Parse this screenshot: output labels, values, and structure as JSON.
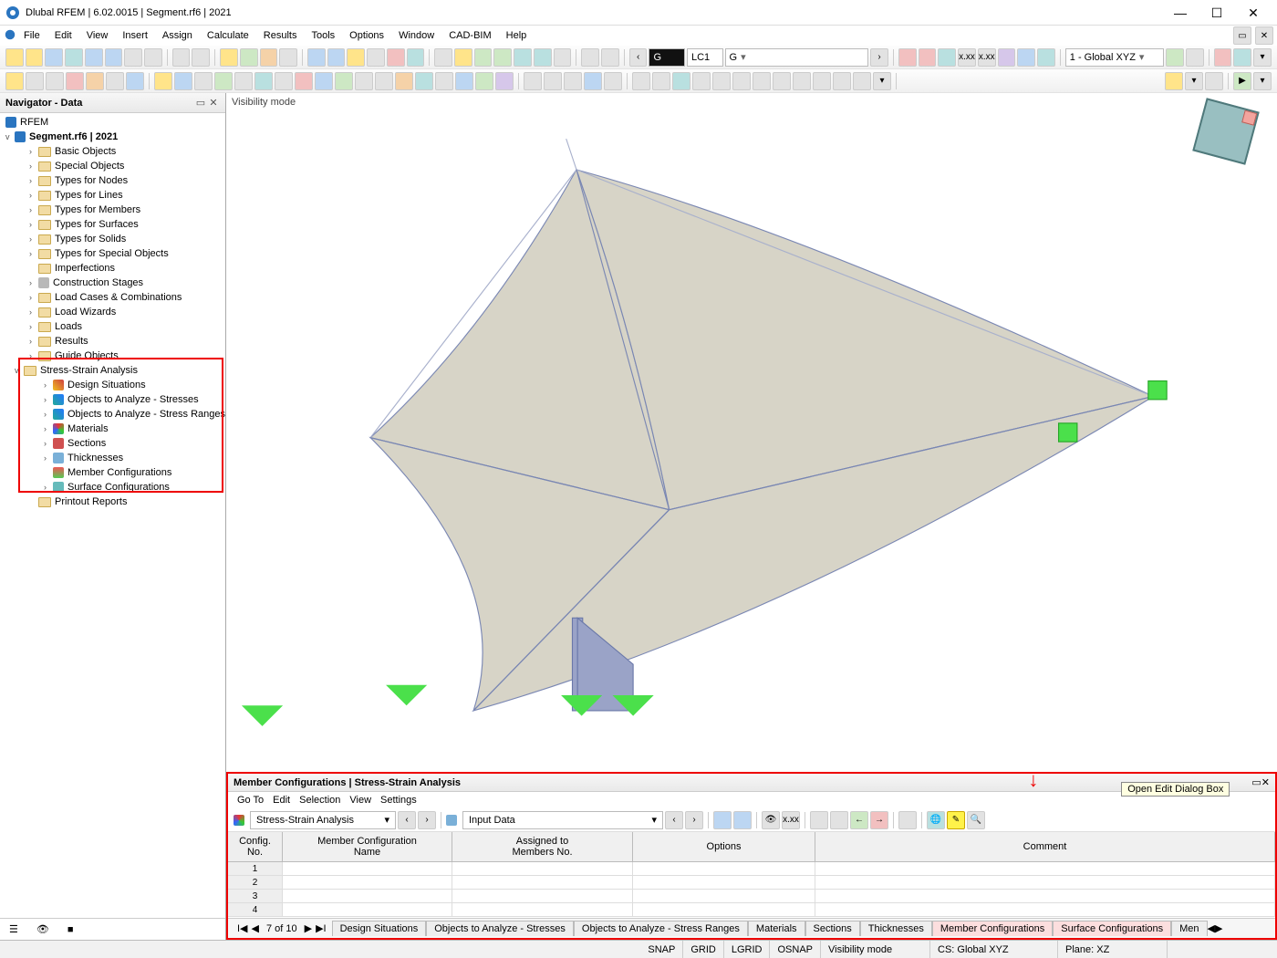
{
  "titlebar": {
    "text": "Dlubal RFEM | 6.02.0015 | Segment.rf6 | 2021"
  },
  "menubar": {
    "items": [
      "File",
      "Edit",
      "View",
      "Insert",
      "Assign",
      "Calculate",
      "Results",
      "Tools",
      "Options",
      "Window",
      "CAD-BIM",
      "Help"
    ]
  },
  "toolbar1": {
    "g_label": "G",
    "lc_code": "LC1",
    "lc_name": "G",
    "coord_sys": "1 - Global XYZ"
  },
  "navigator": {
    "title": "Navigator - Data",
    "root": "RFEM",
    "model": "Segment.rf6 | 2021",
    "basic": [
      "Basic Objects",
      "Special Objects",
      "Types for Nodes",
      "Types for Lines",
      "Types for Members",
      "Types for Surfaces",
      "Types for Solids",
      "Types for Special Objects",
      "Imperfections",
      "Construction Stages",
      "Load Cases & Combinations",
      "Load Wizards",
      "Loads",
      "Results",
      "Guide Objects"
    ],
    "ssa_label": "Stress-Strain Analysis",
    "ssa_children": [
      "Design Situations",
      "Objects to Analyze - Stresses",
      "Objects to Analyze - Stress Ranges",
      "Materials",
      "Sections",
      "Thicknesses",
      "Member Configurations",
      "Surface Configurations"
    ],
    "printout": "Printout Reports"
  },
  "viewport": {
    "mode_label": "Visibility mode"
  },
  "bottom_panel": {
    "title": "Member Configurations | Stress-Strain Analysis",
    "tooltip": "Open Edit Dialog Box",
    "menu": [
      "Go To",
      "Edit",
      "Selection",
      "View",
      "Settings"
    ],
    "combo_left": "Stress-Strain Analysis",
    "combo_right": "Input Data",
    "columns": {
      "no_a": "Config.",
      "no_b": "No.",
      "name_a": "Member Configuration",
      "name_b": "Name",
      "assign_a": "Assigned to",
      "assign_b": "Members No.",
      "opt": "Options",
      "comment": "Comment"
    },
    "rows": [
      "1",
      "2",
      "3",
      "4"
    ],
    "pager": "7 of 10",
    "tabs": [
      "Design Situations",
      "Objects to Analyze - Stresses",
      "Objects to Analyze - Stress Ranges",
      "Materials",
      "Sections",
      "Thicknesses",
      "Member Configurations",
      "Surface Configurations",
      "Men"
    ]
  },
  "statusbar": {
    "items": [
      "SNAP",
      "GRID",
      "LGRID",
      "OSNAP",
      "Visibility mode"
    ],
    "cs": "CS: Global XYZ",
    "plane": "Plane: XZ"
  }
}
